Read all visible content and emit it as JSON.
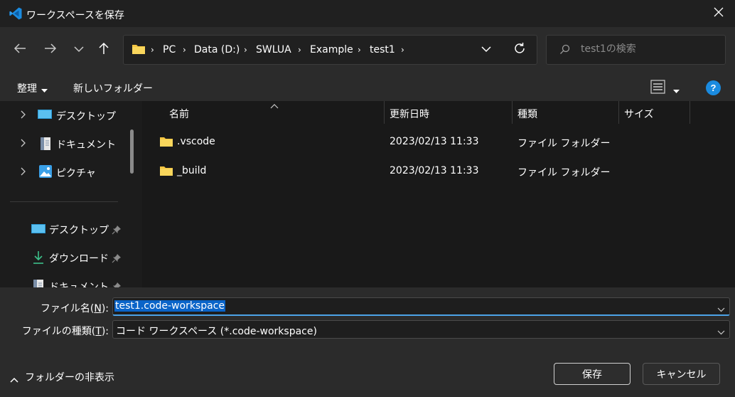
{
  "window": {
    "title": "ワークスペースを保存",
    "app_icon": "vscode-icon",
    "close_icon": "close-icon"
  },
  "nav": {
    "back_icon": "arrow-left-icon",
    "forward_icon": "arrow-right-icon",
    "recent_icon": "chevron-down-icon",
    "up_icon": "arrow-up-icon"
  },
  "address": {
    "crumbs": [
      "PC",
      "Data (D:)",
      "SWLUA",
      "Example",
      "test1"
    ],
    "refresh_icon": "refresh-icon"
  },
  "search": {
    "placeholder": "test1の検索"
  },
  "toolbar": {
    "organize_label": "整理",
    "new_folder_label": "新しいフォルダー",
    "help_label": "?"
  },
  "sidebar": {
    "tree_items": [
      {
        "label": "デスクトップ",
        "icon": "desktop-icon"
      },
      {
        "label": "ドキュメント",
        "icon": "document-icon"
      },
      {
        "label": "ピクチャ",
        "icon": "picture-icon"
      }
    ],
    "quick_items": [
      {
        "label": "デスクトップ",
        "icon": "desktop-icon"
      },
      {
        "label": "ダウンロード",
        "icon": "download-icon"
      },
      {
        "label": "ドキュメント",
        "icon": "document-icon"
      }
    ]
  },
  "filelist": {
    "columns": [
      "名前",
      "更新日時",
      "種類",
      "サイズ"
    ],
    "rows": [
      {
        "name": ".vscode",
        "modified": "2023/02/13 11:33",
        "type": "ファイル フォルダー",
        "size": ""
      },
      {
        "name": "_build",
        "modified": "2023/02/13 11:33",
        "type": "ファイル フォルダー",
        "size": ""
      }
    ]
  },
  "bottom": {
    "filename_label_prefix": "ファイル名(",
    "filename_label_key": "N",
    "filename_label_suffix": "):",
    "filename_value": "test1.code-workspace",
    "filetype_label_prefix": "ファイルの種類(",
    "filetype_label_key": "T",
    "filetype_label_suffix": "):",
    "filetype_value": "コード ワークスペース (*.code-workspace)",
    "hide_folders_label": "フォルダーの非表示",
    "save_label": "保存",
    "cancel_label": "キャンセル"
  },
  "colors": {
    "accent": "#0a64c8",
    "help": "#1a8be0",
    "folder": "#f4c542"
  }
}
